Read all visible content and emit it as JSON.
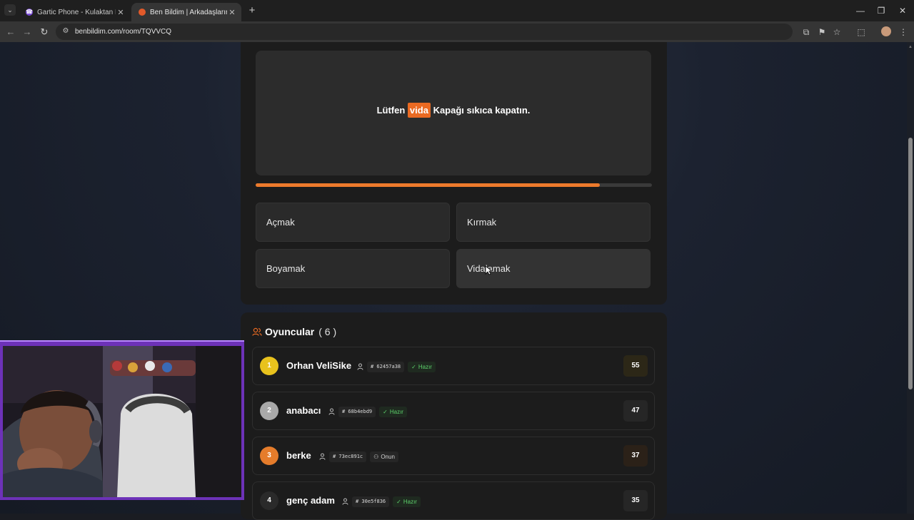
{
  "browser": {
    "tabs": [
      {
        "title": "Gartic Phone - Kulaktan Kulağa",
        "active": false
      },
      {
        "title": "Ben Bildim | Arkadaşlarınla Onli",
        "active": true
      }
    ],
    "url": "benbildim.com/room/TQVVCQ"
  },
  "question": {
    "before": "Lütfen",
    "highlight": "vida",
    "after": "Kapağı sıkıca kapatın."
  },
  "timer": {
    "progress": 0.868
  },
  "options": [
    "Açmak",
    "Kırmak",
    "Boyamak",
    "Vidalamak"
  ],
  "players": {
    "title": "Oyuncular",
    "count": "( 6 )",
    "list": [
      {
        "rank": "1",
        "name": "Orhan VeliSike",
        "id": "# 62457a38",
        "status": "Hazır",
        "score": "55",
        "rank_color": "#e8c21d"
      },
      {
        "rank": "2",
        "name": "anabacı",
        "id": "# 68b4ebd9",
        "status": "Hazır",
        "score": "47",
        "rank_color": "#a9a9a9"
      },
      {
        "rank": "3",
        "name": "berke",
        "id": "# 73ec891c",
        "status": "Onun",
        "score": "37",
        "rank_color": "#e57c2b"
      },
      {
        "rank": "4",
        "name": "genç adam",
        "id": "# 30e5f836",
        "status": "Hazır",
        "score": "35",
        "rank_color": "#2a2a2a"
      }
    ]
  },
  "colors": {
    "accent": "#ea6a22",
    "ready": "#5cd06a",
    "card": "#1c1c1c"
  }
}
